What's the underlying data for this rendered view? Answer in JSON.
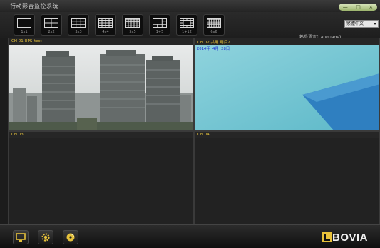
{
  "window": {
    "title": "行动影音监控系统",
    "buttons": [
      "—",
      "□",
      "×"
    ]
  },
  "toolbar": {
    "layouts": [
      {
        "label": "1x1",
        "icon": "layout-1x1-icon"
      },
      {
        "label": "2x2",
        "icon": "layout-2x2-icon"
      },
      {
        "label": "3x3",
        "icon": "layout-3x3-icon"
      },
      {
        "label": "4x4",
        "icon": "layout-4x4-icon"
      },
      {
        "label": "5x5",
        "icon": "layout-5x5-icon"
      },
      {
        "label": "1+5",
        "icon": "layout-1plus5-icon"
      },
      {
        "label": "1+12",
        "icon": "layout-1plus12-icon"
      },
      {
        "label": "6x6",
        "icon": "layout-6x6-icon"
      }
    ],
    "language_label": "熟悉语言(Language)",
    "language_value": "繁體中文"
  },
  "channels": [
    {
      "title": "CH 01 UPS_test"
    },
    {
      "title": "CH 02 共用 用戶2",
      "overlay": "2014年  4月  28日"
    },
    {
      "title": "CH 03"
    },
    {
      "title": "CH 04"
    }
  ],
  "bottombar": {
    "buttons": [
      {
        "icon": "monitor-icon"
      },
      {
        "icon": "gear-icon"
      },
      {
        "icon": "disc-icon"
      }
    ],
    "logo_text": "BOVIA"
  },
  "colors": {
    "accent": "#e5c13b",
    "titlebar": "#2f2f2f",
    "panel": "#222222"
  }
}
